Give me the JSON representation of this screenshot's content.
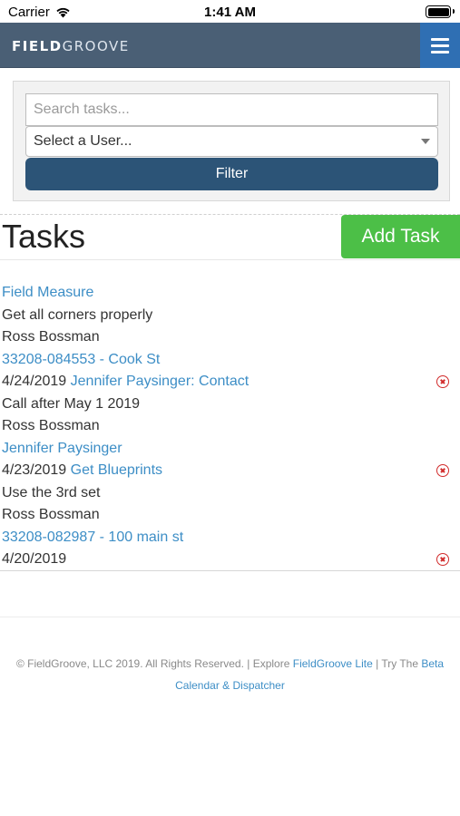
{
  "status_bar": {
    "carrier": "Carrier",
    "time": "1:41 AM"
  },
  "navbar": {
    "brand_bold": "FIELD",
    "brand_light": "GROOVE"
  },
  "filter": {
    "search_placeholder": "Search tasks...",
    "user_select_value": "Select a User...",
    "filter_button": "Filter"
  },
  "tasks": {
    "title": "Tasks",
    "add_button": "Add Task",
    "items": [
      {
        "title_link": "Field Measure",
        "description": "Get all corners properly",
        "assignee": "Ross Bossman",
        "related_link": "33208-084553 - Cook St",
        "due_date": "4/24/2019"
      },
      {
        "title_link": "Jennifer Paysinger: Contact",
        "description": "Call after May 1 2019",
        "assignee": "Ross Bossman",
        "related_link": "Jennifer Paysinger",
        "due_date": "4/23/2019"
      },
      {
        "title_link": "Get Blueprints",
        "description": "Use the 3rd set",
        "assignee": "Ross Bossman",
        "related_link": "33208-082987 - 100 main st",
        "due_date": "4/20/2019"
      }
    ]
  },
  "footer": {
    "copyright": "© FieldGroove, LLC 2019. All Rights Reserved. | Explore ",
    "lite_link": "FieldGroove Lite",
    "try_text": " | Try The ",
    "beta_link": "Beta Calendar & Dispatcher"
  },
  "colors": {
    "navbar": "#4a5f75",
    "menu_button": "#2f6fb3",
    "filter_button": "#2c5477",
    "add_task": "#4cbf47",
    "link": "#3d8ec6",
    "delete": "#d12b2b"
  }
}
